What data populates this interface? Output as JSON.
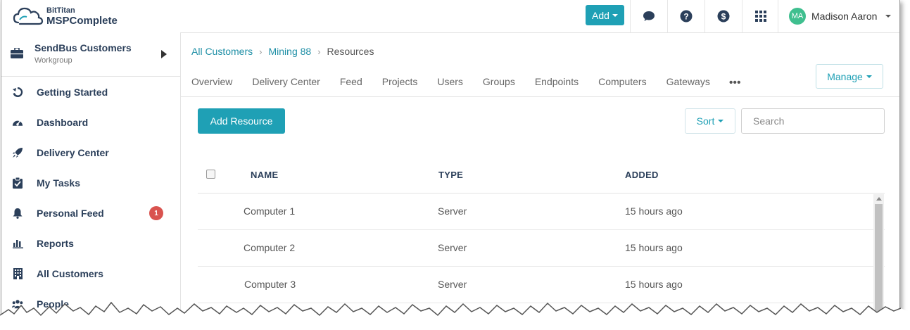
{
  "brand": {
    "line1": "BitTitan",
    "line2": "MSPComplete"
  },
  "topbar": {
    "add_label": "Add",
    "icons": [
      "chat-icon",
      "help-icon",
      "dollar-icon",
      "apps-grid-icon"
    ],
    "user": {
      "initials": "MA",
      "name": "Madison Aaron"
    }
  },
  "workgroup": {
    "title": "SendBus Customers",
    "subtitle": "Workgroup"
  },
  "sidebar": {
    "items": [
      {
        "label": "Getting Started",
        "icon": "getting-started-icon"
      },
      {
        "label": "Dashboard",
        "icon": "dashboard-icon"
      },
      {
        "label": "Delivery Center",
        "icon": "rocket-icon"
      },
      {
        "label": "My Tasks",
        "icon": "clipboard-check-icon"
      },
      {
        "label": "Personal Feed",
        "icon": "bell-icon",
        "badge": "1"
      },
      {
        "label": "Reports",
        "icon": "bar-chart-icon"
      },
      {
        "label": "All Customers",
        "icon": "building-icon"
      },
      {
        "label": "People",
        "icon": "people-icon"
      }
    ]
  },
  "breadcrumb": {
    "items": [
      "All Customers",
      "Mining 88"
    ],
    "current": "Resources"
  },
  "tabs": [
    "Overview",
    "Delivery Center",
    "Feed",
    "Projects",
    "Users",
    "Groups",
    "Endpoints",
    "Computers",
    "Gateways"
  ],
  "toolbar": {
    "manage_label": "Manage",
    "add_resource_label": "Add Resource",
    "sort_label": "Sort",
    "search_placeholder": "Search"
  },
  "table": {
    "headers": [
      "NAME",
      "TYPE",
      "ADDED"
    ],
    "rows": [
      {
        "name": "Computer 1",
        "type": "Server",
        "added": "15 hours ago"
      },
      {
        "name": "Computer 2",
        "type": "Server",
        "added": "15 hours ago"
      },
      {
        "name": "Computer 3",
        "type": "Server",
        "added": "15 hours ago"
      }
    ]
  },
  "colors": {
    "accent": "#1fa0b5",
    "nav_text": "#2b3f5a",
    "badge": "#d9534f",
    "avatar": "#3fbf8f"
  }
}
